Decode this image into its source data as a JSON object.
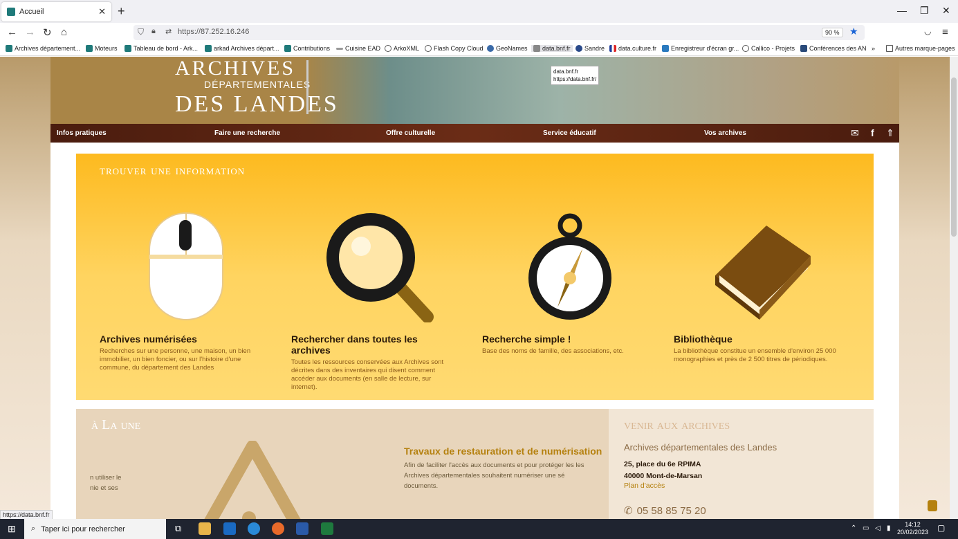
{
  "browser": {
    "tab_title": "Accueil",
    "url": "https://87.252.16.246",
    "zoom": "90 %",
    "bookmarks": [
      "Archives département...",
      "Moteurs",
      "Tableau de bord - Ark...",
      "arkad Archives départ...",
      "Contributions",
      "Cuisine EAD",
      "ArkoXML",
      "Flash Copy Cloud",
      "GeoNames",
      "data.bnf.fr",
      "Sandre",
      "data.culture.fr",
      "Enregistreur d'écran gr...",
      "Callico - Projets",
      "Conférences des AN",
      "Autres marque-pages"
    ],
    "tooltip_line1": "data.bnf.fr",
    "tooltip_line2": "https://data.bnf.fr/",
    "status_url": "https://data.bnf.fr"
  },
  "site": {
    "logo_line1": "ARCHIVES",
    "logo_line2": "DÉPARTEMENTALES",
    "logo_line3": "DES LANDES",
    "menu": [
      "Infos pratiques",
      "Faire une recherche",
      "Offre culturelle",
      "Service éducatif",
      "Vos archives"
    ],
    "find_title": "trouver une information",
    "cards": [
      {
        "title": "Archives numérisées",
        "desc": "Recherches sur une personne, une maison, un bien immobilier, un bien foncier, ou sur l'histoire d'une commune, du département des Landes"
      },
      {
        "title": "Rechercher dans toutes les archives",
        "desc": "Toutes les ressources conservées aux Archives sont décrites dans des inventaires qui disent comment accéder aux documents (en salle de lecture, sur internet)."
      },
      {
        "title": "Recherche simple !",
        "desc": "Base des noms de famille, des associations, etc."
      },
      {
        "title": "Bibliothèque",
        "desc": "La bibliothèque constitue un ensemble d'environ 25 000 monographies et près de 2 500 titres de périodiques."
      }
    ],
    "une_title": "à La une",
    "une_article_title": "Travaux de restauration et de numérisation",
    "une_article_desc": "Afin de faciliter l'accès aux documents et pour protéger les les Archives départementales souhaitent numériser une sé documents.",
    "une_cut_line1": "n utiliser le",
    "une_cut_line2": "nie et ses",
    "venir_title": "venir aux archives",
    "venir_name": "Archives départementales des Landes",
    "venir_addr1": "25, place du 6e RPIMA",
    "venir_addr2": "40000 Mont-de-Marsan",
    "venir_plan": "Plan d'accès",
    "venir_phone": "05 58 85 75 20"
  },
  "taskbar": {
    "search_placeholder": "Taper ici pour rechercher",
    "time": "14:12",
    "date": "20/02/2023"
  },
  "colors": {
    "accent_yellow": "#fdba1f",
    "menu_brown": "#4a1c0e",
    "link_gold": "#b5810f"
  }
}
